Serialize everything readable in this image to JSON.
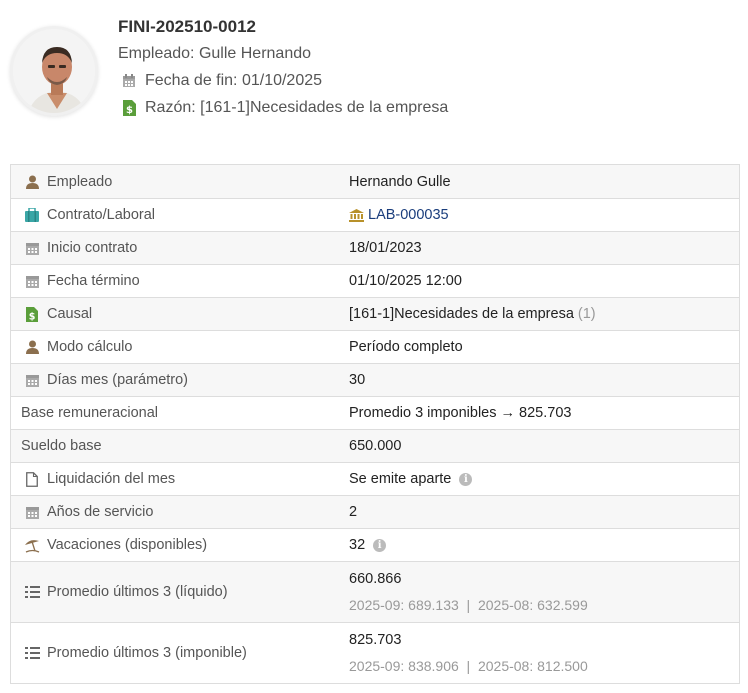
{
  "header": {
    "title": "FINI-202510-0012",
    "employee_line": "Empleado: Gulle Hernando",
    "end_date_line": "Fecha de fin: 01/10/2025",
    "reason_line": "Razón: [161-1]Necesidades de la empresa"
  },
  "rows": [
    {
      "label": "Empleado",
      "value": "Hernando Gulle",
      "icon": "user-icon"
    },
    {
      "label": "Contrato/Laboral",
      "value": "LAB-000035",
      "icon": "briefcase-icon"
    },
    {
      "label": "Inicio contrato",
      "value": "18/01/2023",
      "icon": "calendar-icon"
    },
    {
      "label": "Fecha término",
      "value": "01/10/2025 12:00",
      "icon": "calendar-icon"
    },
    {
      "label": "Causal",
      "value": "[161-1]Necesidades de la empresa",
      "extra": "(1)",
      "icon": "money-document-icon"
    },
    {
      "label": "Modo cálculo",
      "value": "Período completo",
      "icon": "user-icon"
    },
    {
      "label": "Días mes (parámetro)",
      "value": "30",
      "icon": "calendar-icon"
    },
    {
      "label": "Base remuneracional",
      "value": "Promedio 3 imponibles → 825.703"
    },
    {
      "label": "Sueldo base",
      "value": "650.000"
    },
    {
      "label": "Liquidación del mes",
      "value": "Se emite aparte",
      "icon": "document-icon"
    },
    {
      "label": "Años de servicio",
      "value": "2",
      "icon": "calendar-icon"
    },
    {
      "label": "Vacaciones (disponibles)",
      "value": "32",
      "icon": "beach-umbrella-icon"
    },
    {
      "label": "Promedio últimos 3 (líquido)",
      "value": "660.866",
      "sub": "2025-09: 689.133  |  2025-08: 632.599",
      "icon": "list-icon"
    },
    {
      "label": "Promedio últimos 3 (imponible)",
      "value": "825.703",
      "sub": "2025-09: 838.906  |  2025-08: 812.500",
      "icon": "list-icon"
    }
  ],
  "colors": {
    "icon_brown": "#8b6f4e",
    "icon_teal": "#3aa6a6",
    "icon_green": "#5a9e3a",
    "icon_gray": "#aaaaaa",
    "link": "#1a3d7c",
    "muted": "#999999"
  },
  "info_glyph": "i"
}
